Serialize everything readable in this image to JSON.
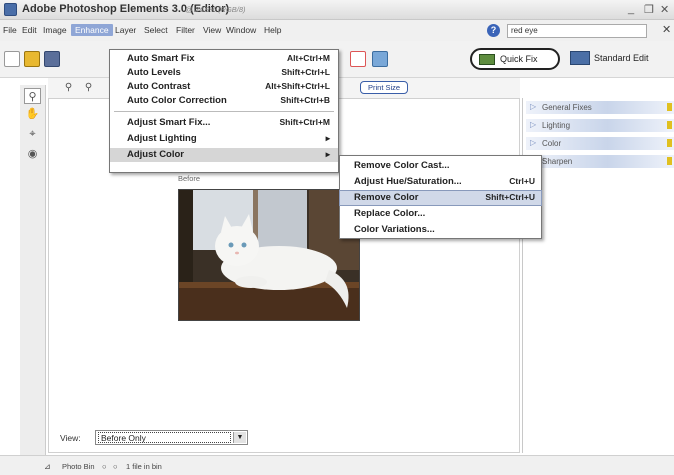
{
  "window": {
    "title": "Adobe Photoshop Elements 3.0 (Editor)",
    "subtitle": "@ 24.9% (RGB/8)",
    "controls": [
      "_",
      "❐",
      "✕"
    ]
  },
  "menubar": {
    "items": [
      "File",
      "Edit",
      "Image",
      "Enhance",
      "Layer",
      "Select",
      "Filter",
      "View",
      "Window",
      "Help"
    ],
    "active": "Enhance",
    "help_search_value": "red eye",
    "close_glyph": "✕"
  },
  "toolbar": {
    "quick_fix_label": "Quick Fix",
    "standard_edit_label": "Standard Edit",
    "print_size_label": "Print Size"
  },
  "enhance_menu": {
    "items": [
      {
        "label": "Auto Smart Fix",
        "shortcut": "Alt+Ctrl+M"
      },
      {
        "label": "Auto Levels",
        "shortcut": "Shift+Ctrl+L"
      },
      {
        "label": "Auto Contrast",
        "shortcut": "Alt+Shift+Ctrl+L"
      },
      {
        "label": "Auto Color Correction",
        "shortcut": "Shift+Ctrl+B"
      },
      {
        "label": "Adjust Smart Fix...",
        "shortcut": "Shift+Ctrl+M"
      },
      {
        "label": "Adjust Lighting",
        "shortcut": "▸"
      },
      {
        "label": "Adjust Color",
        "shortcut": "▸"
      }
    ]
  },
  "adjust_color_menu": {
    "items": [
      {
        "label": "Remove Color Cast...",
        "shortcut": ""
      },
      {
        "label": "Adjust Hue/Saturation...",
        "shortcut": "Ctrl+U"
      },
      {
        "label": "Remove Color",
        "shortcut": "Shift+Ctrl+U"
      },
      {
        "label": "Replace Color...",
        "shortcut": ""
      },
      {
        "label": "Color Variations...",
        "shortcut": ""
      }
    ],
    "highlighted": "Remove Color"
  },
  "canvas": {
    "before_label": "Before",
    "views_label": "View:",
    "views_value": "Before Only"
  },
  "palette": {
    "items": [
      "General Fixes",
      "Lighting",
      "Color",
      "Sharpen"
    ]
  },
  "statusbar": {
    "photo_bin_label": "Photo Bin",
    "files_label": "1 file in bin"
  },
  "colors": {
    "menu_highlight": "#8fa6d6",
    "selection_fill": "#d0d8e8",
    "palette_gradient": "#c9d5ea"
  }
}
